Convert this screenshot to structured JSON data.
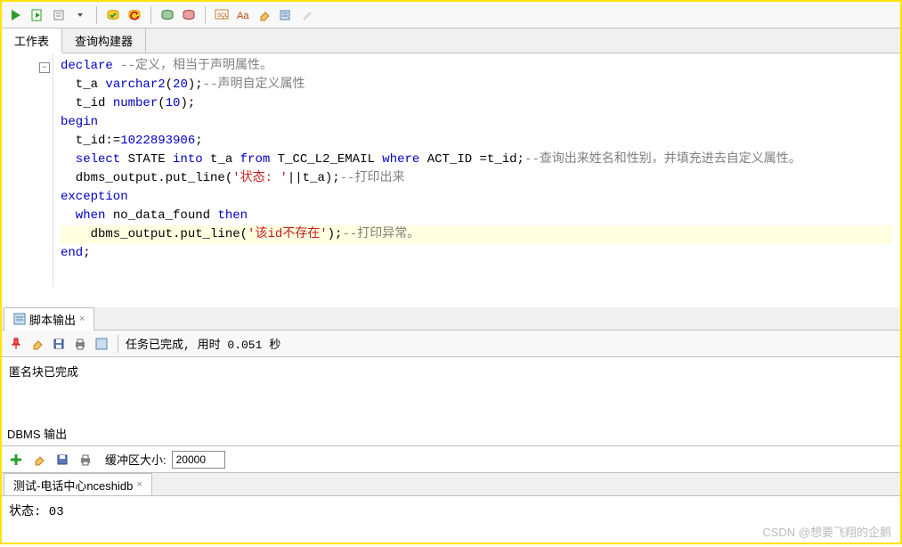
{
  "tabs": {
    "worksheet": "工作表",
    "query_builder": "查询构建器"
  },
  "code": {
    "l1_kw": "declare",
    "l1_cm": " --定义，相当于声明属性。",
    "l2a": "  t_a ",
    "l2_kw": "varchar2",
    "l2b": "(",
    "l2_num": "20",
    "l2c": ");",
    "l2_cm": "--声明自定义属性",
    "l3a": "  t_id ",
    "l3_kw": "number",
    "l3b": "(",
    "l3_num": "10",
    "l3c": ");",
    "l4_kw": "begin",
    "l5a": "  t_id:=",
    "l5_num": "1022893906",
    "l5b": ";",
    "l6_kw1": "  select",
    "l6a": " STATE ",
    "l6_kw2": "into",
    "l6b": " t_a ",
    "l6_kw3": "from",
    "l6c": " T_CC_L2_EMAIL ",
    "l6_kw4": "where",
    "l6d": " ACT_ID =t_id;",
    "l6_cm": "--查询出来姓名和性别，并填充进去自定义属性。",
    "l7a": "  dbms_output.put_line(",
    "l7_str": "'状态: '",
    "l7b": "||t_a);",
    "l7_cm": "--打印出来",
    "l8_kw": "exception",
    "l9_kw": "  when",
    "l9a": " no_data_found ",
    "l9_kw2": "then",
    "l10a": "    dbms_output.put_line(",
    "l10_str": "'该id不存在'",
    "l10b": ");",
    "l10_cm": "--打印异常。",
    "l11_kw": "end",
    "l11a": ";"
  },
  "output": {
    "tab_label": "脚本输出",
    "status": "任务已完成, 用时 0.051 秒",
    "result": "匿名块已完成"
  },
  "dbms": {
    "title": "DBMS 输出",
    "buffer_label": "缓冲区大小:",
    "buffer_value": "20000",
    "conn_tab": "测试-电话中心nceshidb",
    "body": "状态: 03"
  },
  "watermark": "CSDN @想要飞翔的企鹅"
}
